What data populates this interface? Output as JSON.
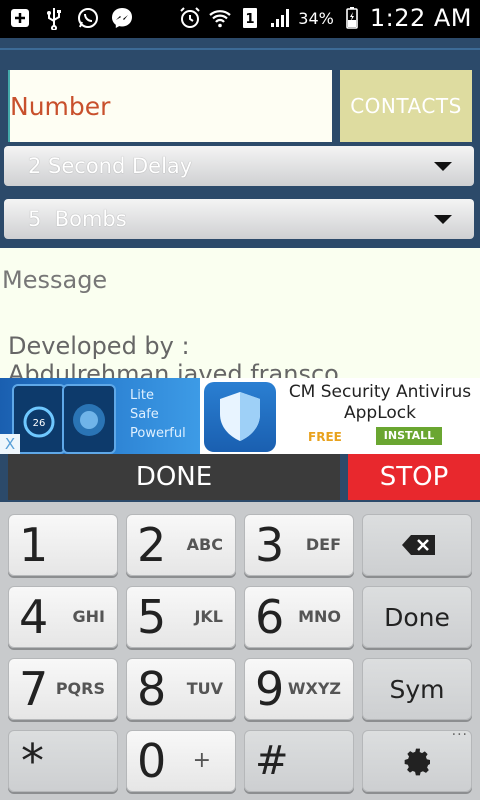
{
  "status_bar": {
    "battery": "34%",
    "time": "1:22 AM",
    "icons": [
      "add-icon",
      "usb-icon",
      "whatsapp-icon",
      "messenger-icon",
      "alarm-icon",
      "wifi-icon",
      "sim-icon",
      "signal-icon",
      "battery-charging-icon"
    ]
  },
  "form": {
    "number_placeholder": "Number",
    "contacts_label": "CONTACTS",
    "delay_value": "2 Second Delay",
    "bombs_value": "5  Bombs"
  },
  "message": {
    "placeholder": "Message",
    "developer_label": "Developed by :",
    "developer_name": "Abdulrehman javed fransco"
  },
  "ad": {
    "tagline": [
      "Lite",
      "Safe",
      "Powerful"
    ],
    "title": "CM Security Antivirus AppLock",
    "free_label": "FREE",
    "install_label": "INSTALL",
    "close_label": "X"
  },
  "actions": {
    "done_label": "DONE",
    "stop_label": "STOP"
  },
  "keypad": {
    "keys": [
      {
        "digit": "1",
        "letters": ""
      },
      {
        "digit": "2",
        "letters": "ABC"
      },
      {
        "digit": "3",
        "letters": "DEF"
      },
      {
        "digit": "4",
        "letters": "GHI"
      },
      {
        "digit": "5",
        "letters": "JKL"
      },
      {
        "digit": "6",
        "letters": "MNO"
      },
      {
        "digit": "7",
        "letters": "PQRS"
      },
      {
        "digit": "8",
        "letters": "TUV"
      },
      {
        "digit": "9",
        "letters": "WXYZ"
      },
      {
        "digit": "*",
        "letters": ""
      },
      {
        "digit": "0",
        "letters": "+"
      },
      {
        "digit": "#",
        "letters": ""
      }
    ],
    "done_label": "Done",
    "sym_label": "Sym",
    "more_label": "···"
  },
  "colors": {
    "panel_bg": "#2c4a6a",
    "placeholder_text": "#c8502c",
    "contacts_bg": "#dedca0",
    "stop_bg": "#e8282d",
    "done_bg": "#3b3b3b"
  }
}
